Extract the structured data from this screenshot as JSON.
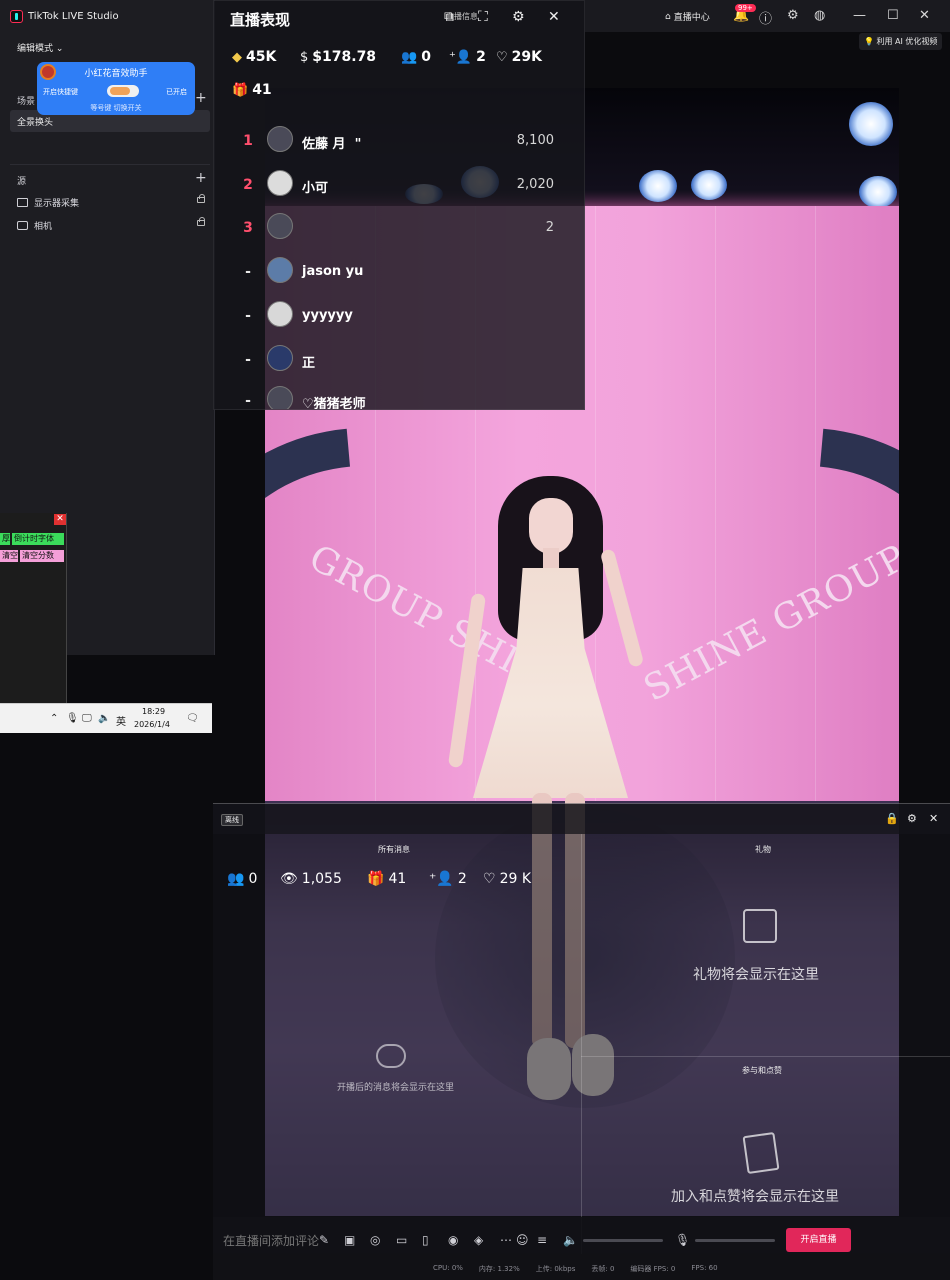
{
  "app": {
    "title": "TikTok LIVE Studio",
    "edit_mode": "编辑模式",
    "scene_label": "场景",
    "scene_item": "全景换头",
    "source_label": "源",
    "sources": [
      {
        "label": "显示器采集",
        "icon": "monitor-icon"
      },
      {
        "label": "相机",
        "icon": "camera-icon"
      }
    ],
    "add_symbol": "+"
  },
  "helper": {
    "title": "小红花音效助手",
    "left_label": "开启快捷键",
    "right_label": "已开启",
    "hint": "等号键 切换开关"
  },
  "mini_tool": {
    "close": "✕",
    "btn_1": "厚",
    "btn_2": "倒计时字体",
    "btn_3": "清空",
    "btn_4": "清空分数"
  },
  "taskbar": {
    "ime": "英",
    "time": "18:29",
    "date": "2026/1/4"
  },
  "topbar": {
    "live_center": "直播中心",
    "badge": "99+",
    "ai_optimize": "利用 AI 优化视频"
  },
  "stats_panel": {
    "title": "直播表现",
    "overlay_label": "直播信息",
    "diamonds": "45K",
    "earnings": "$178.78",
    "viewers": "0",
    "new_followers": "2",
    "likes": "29K",
    "gifts": "41",
    "ranking": [
      {
        "rank": "1",
        "name": "佐藤 月  \"",
        "score": "8,100"
      },
      {
        "rank": "2",
        "name": "小可",
        "score": "2,020"
      },
      {
        "rank": "3",
        "name": "",
        "score": "2"
      },
      {
        "rank": "-",
        "name": "jason yu",
        "score": ""
      },
      {
        "rank": "-",
        "name": "yyyyyy",
        "score": ""
      },
      {
        "rank": "-",
        "name": "正",
        "score": ""
      },
      {
        "rank": "-",
        "name": "♡猪猪老师",
        "score": ""
      }
    ]
  },
  "chat_panel": {
    "offline": "离线",
    "all_messages": "所有消息",
    "gifts_label": "礼物",
    "viewers": "0",
    "views": "1,055",
    "gifts": "41",
    "followers": "2",
    "likes": "29 K",
    "gift_empty": "礼物将会显示在这里",
    "join_like_label": "参与和点赞",
    "join_empty": "加入和点赞将会显示在这里",
    "chat_empty": "开播后的消息将会显示在这里"
  },
  "bottom_bar": {
    "input_placeholder": "在直播间添加评论",
    "go_live": "开启直播",
    "perf": [
      "CPU: 0%",
      "内存: 1.32%",
      "上传: 0kbps",
      "丢帧: 0",
      "编码器 FPS: 0",
      "FPS: 60"
    ]
  },
  "colors": {
    "accent": "#fe2c55",
    "go_live": "#e1275a",
    "helper_blue": "#2f7ef6",
    "rank_red": "#ff4f6d"
  }
}
